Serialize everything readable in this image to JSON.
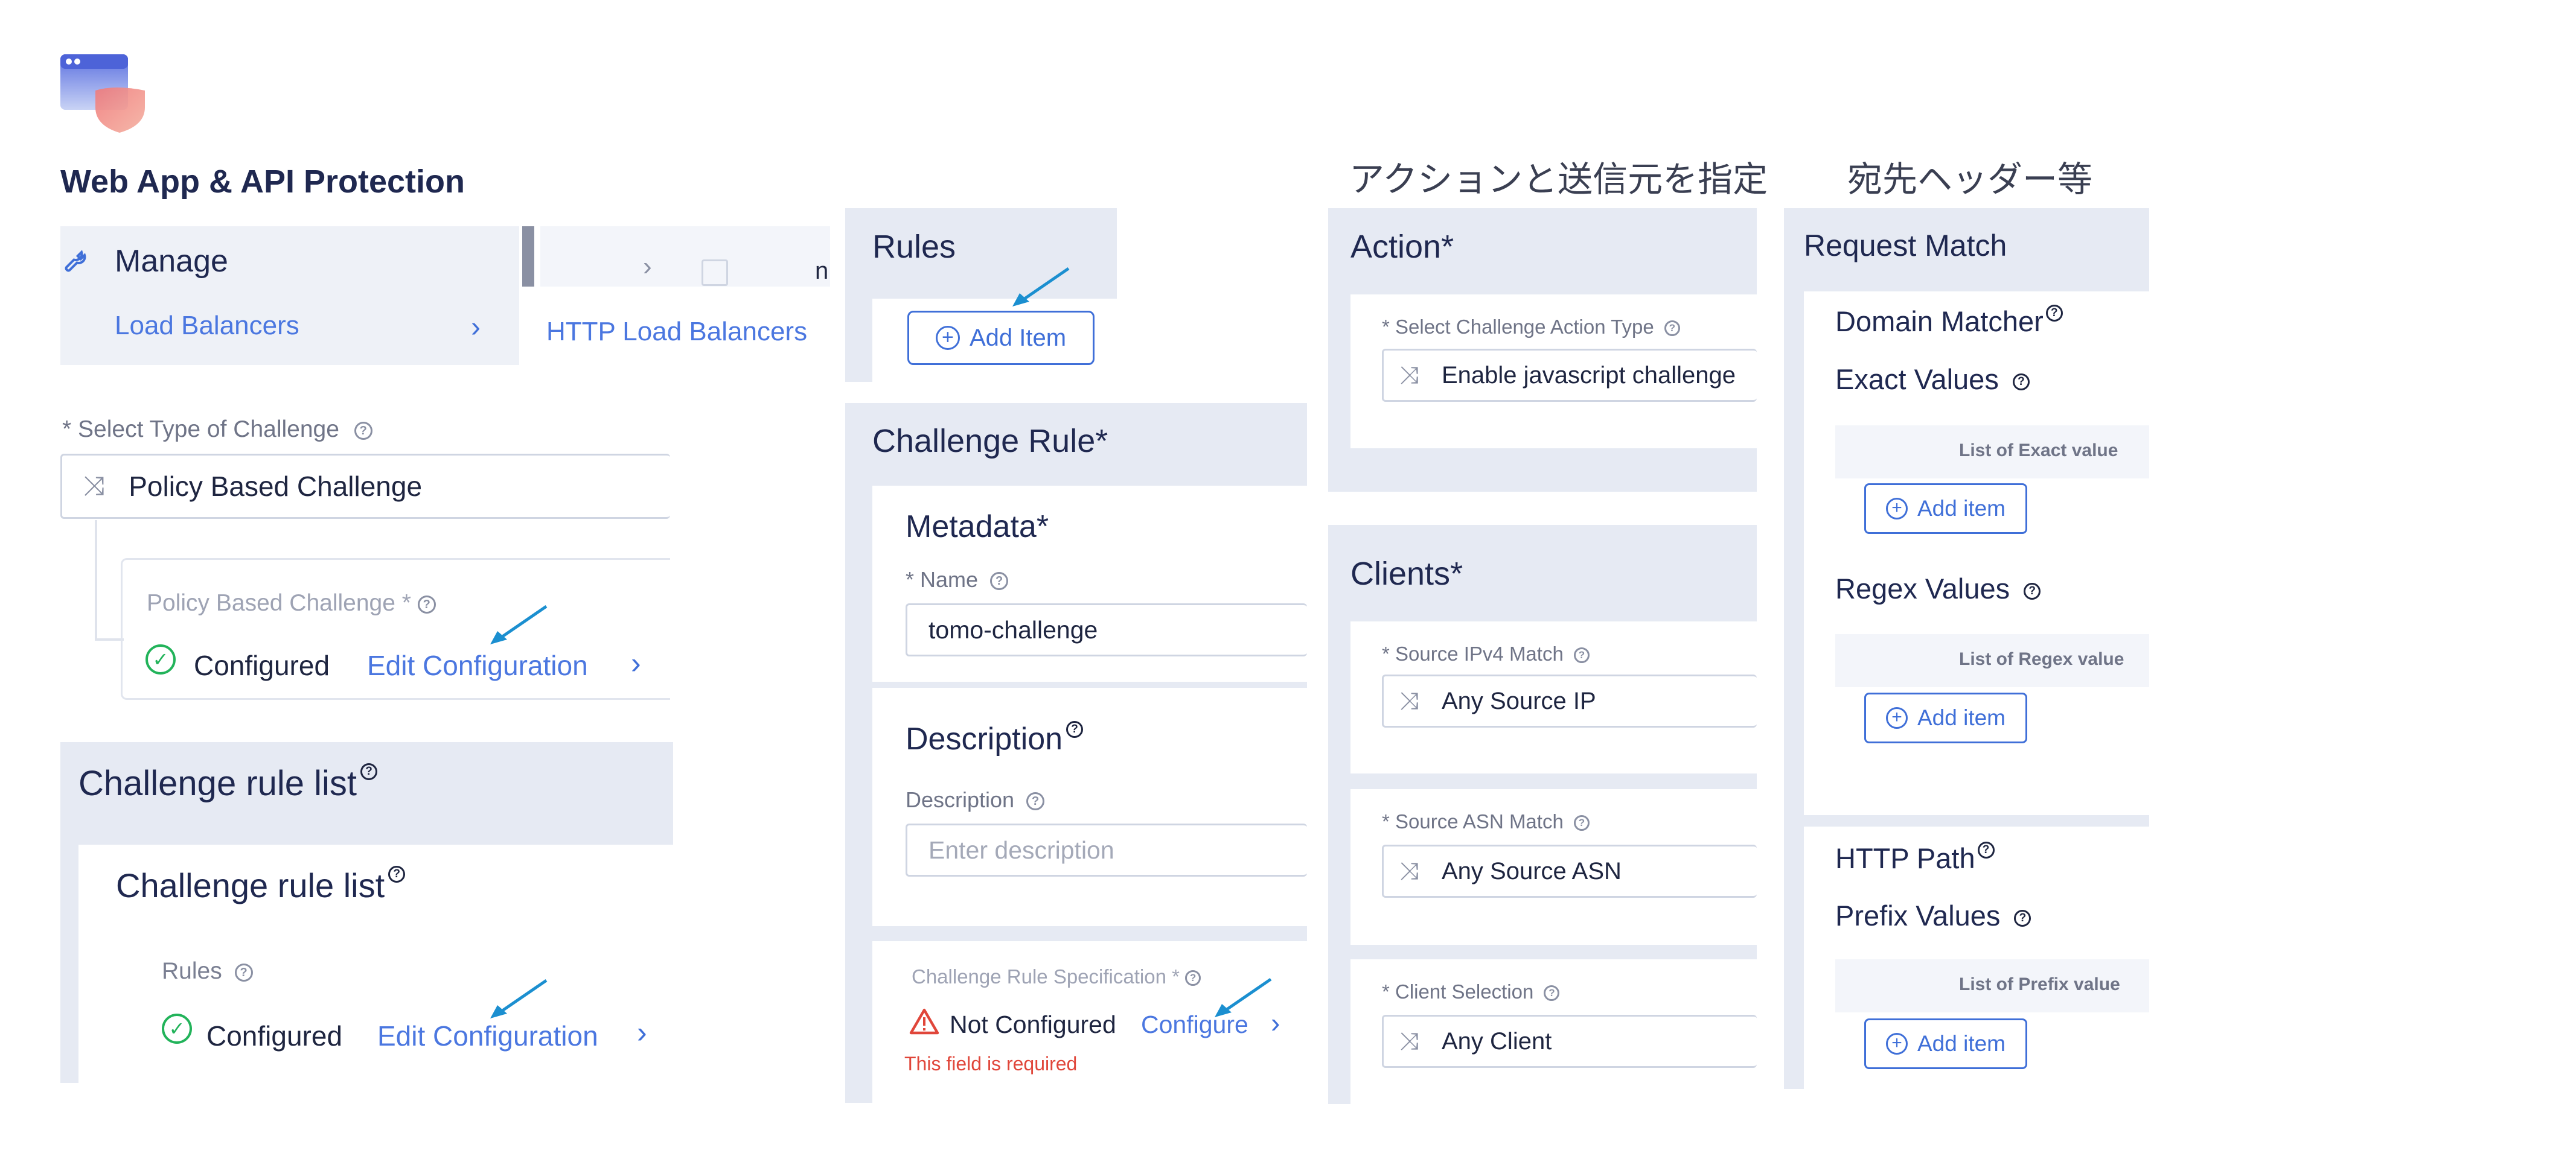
{
  "app": {
    "title": "Web App & API Protection"
  },
  "manage": {
    "label": "Manage",
    "nav_item": "Load Balancers",
    "nav_child": "HTTP Load Balancers",
    "partial_header": "n"
  },
  "challenge_type": {
    "label": "* Select Type of Challenge",
    "value": "Policy Based Challenge",
    "policy_label": "Policy Based Challenge *",
    "status": "Configured",
    "edit_link": "Edit Configuration"
  },
  "rule_list": {
    "title": "Challenge rule list",
    "inner_title": "Challenge rule list",
    "rules_label": "Rules",
    "status": "Configured",
    "edit_link": "Edit Configuration"
  },
  "rules_panel": {
    "title": "Rules",
    "add_button": "Add Item"
  },
  "challenge_rule": {
    "title": "Challenge Rule",
    "required_mark": "*",
    "metadata_title": "Metadata",
    "name_label": "* Name",
    "name_value": "tomo-challenge",
    "description_title": "Description",
    "description_label": "Description",
    "description_placeholder": "Enter description",
    "spec_label": "Challenge Rule Specification *",
    "spec_status": "Not Configured",
    "configure_link": "Configure",
    "error_text": "This field is required"
  },
  "action_panel": {
    "caption": "アクションと送信元を指定",
    "title": "Action",
    "type_label": "* Select Challenge Action Type",
    "type_value": "Enable javascript challenge",
    "clients_title": "Clients",
    "ipv4_label": "* Source IPv4 Match",
    "ipv4_value": "Any Source IP",
    "asn_label": "* Source ASN Match",
    "asn_value": "Any Source ASN",
    "client_label": "* Client Selection",
    "client_value": "Any Client"
  },
  "request_panel": {
    "caption": "宛先ヘッダー等",
    "title": "Request Match",
    "domain_title": "Domain Matcher",
    "exact_title": "Exact Values",
    "exact_list": "List of Exact value",
    "regex_title": "Regex Values",
    "regex_list": "List of Regex value",
    "path_title": "HTTP Path",
    "prefix_title": "Prefix Values",
    "prefix_list": "List of Prefix value",
    "add_item": "Add item"
  },
  "colors": {
    "accent": "#3f6fd8",
    "arrow": "#1b8fd0",
    "success": "#22b35a",
    "error": "#e0463a",
    "panel": "#e6eaf3"
  },
  "icons": [
    "app-protection-icon",
    "wrench-icon",
    "chevron-right-icon",
    "help-icon",
    "check-circle-icon",
    "warning-icon",
    "shuffle-icon",
    "plus-circle-icon",
    "pointer-arrow-icon"
  ]
}
